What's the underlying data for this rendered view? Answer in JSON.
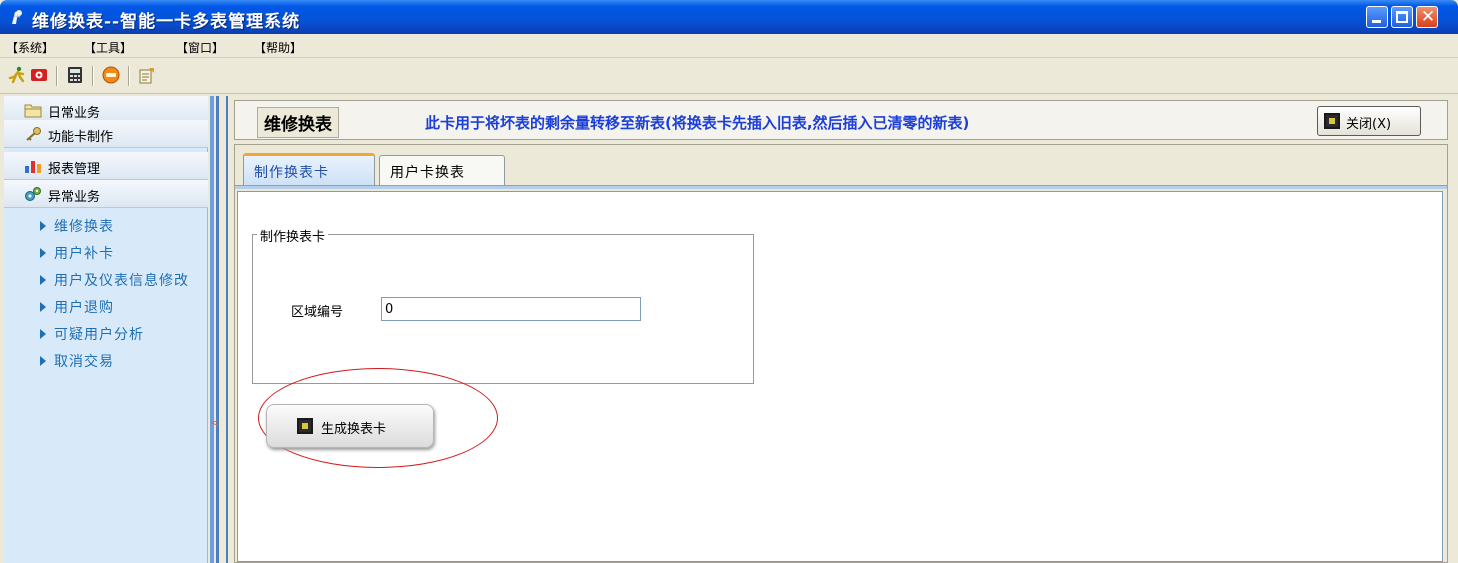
{
  "window": {
    "title": "维修换表--智能一卡多表管理系统"
  },
  "menu": {
    "items": [
      "【系统】",
      "【工具】",
      "【窗口】",
      "【帮助】"
    ]
  },
  "sidebar": {
    "sections": [
      {
        "label": "日常业务",
        "icon": "folder-icon"
      },
      {
        "label": "功能卡制作",
        "icon": "key-icon"
      },
      {
        "label": "报表管理",
        "icon": "bar-chart-icon"
      },
      {
        "label": "异常业务",
        "icon": "gears-icon"
      }
    ],
    "links": [
      "维修换表",
      "用户补卡",
      "用户及仪表信息修改",
      "用户退购",
      "可疑用户分析",
      "取消交易"
    ]
  },
  "header": {
    "title": "维修换表",
    "description": "此卡用于将坏表的剩余量转移至新表(将换表卡先插入旧表,然后插入已清零的新表)",
    "close_label": "关闭(X)"
  },
  "tabs": [
    {
      "label": "制作换表卡",
      "active": true
    },
    {
      "label": "用户卡换表",
      "active": false
    }
  ],
  "form": {
    "group_title": "制作换表卡",
    "area_label": "区域编号",
    "area_value": "0",
    "generate_label": "生成换表卡"
  },
  "colors": {
    "titlebar": "#0552d6",
    "link": "#1f6fb5",
    "description": "#1c3fd8",
    "annotation": "#d21a1a"
  }
}
